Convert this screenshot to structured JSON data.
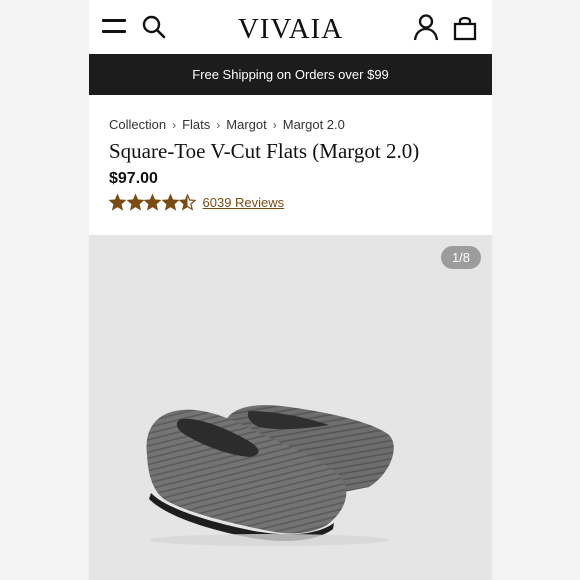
{
  "header": {
    "logo": "VIVAIA",
    "menu_icon": "hamburger-menu-icon",
    "search_icon": "search-icon",
    "account_icon": "user-icon",
    "bag_icon": "shopping-bag-icon"
  },
  "promo": {
    "text": "Free Shipping on Orders over $99"
  },
  "breadcrumb": {
    "items": [
      "Collection",
      "Flats",
      "Margot",
      "Margot 2.0"
    ],
    "separator_icon": "chevron-right-icon"
  },
  "product": {
    "title": "Square-Toe V-Cut Flats (Margot 2.0)",
    "price": "$97.00",
    "rating": 4.5,
    "rating_max": 5,
    "reviews_label": "6039 Reviews",
    "star_color": "#7a4c14"
  },
  "gallery": {
    "counter": "1/8",
    "image_subject": "grey knit flats"
  }
}
